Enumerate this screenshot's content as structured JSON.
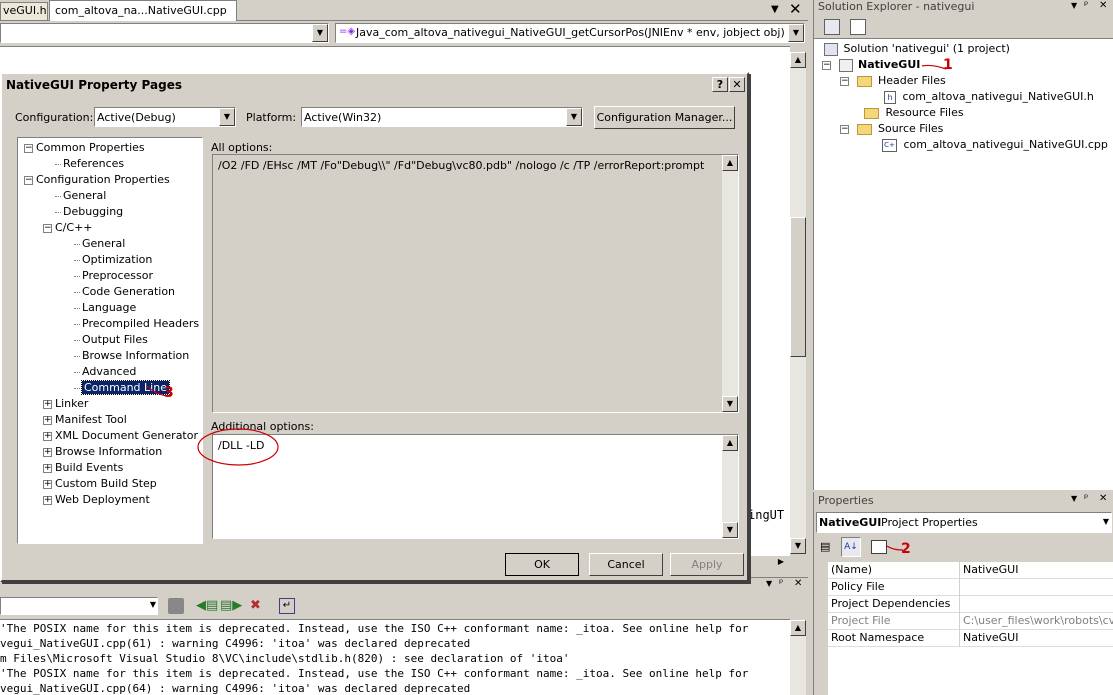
{
  "editor": {
    "tabs": [
      "veGUI.h",
      "com_altova_na...NativeGUI.cpp"
    ],
    "function_dropdown": "Java_com_altova_nativegui_NativeGUI_getCursorPos(JNIEnv * env, jobject obj)",
    "code_fragment": "ingUT"
  },
  "dialog": {
    "title": "NativeGUI Property Pages",
    "help_label": "?",
    "configuration_label": "Configuration:",
    "configuration_value": "Active(Debug)",
    "platform_label": "Platform:",
    "platform_value": "Active(Win32)",
    "config_manager_label": "Configuration Manager...",
    "tree": [
      {
        "label": "Common Properties",
        "expander": "−"
      },
      {
        "label": "References"
      },
      {
        "label": "Configuration Properties",
        "expander": "−"
      },
      {
        "label": "General"
      },
      {
        "label": "Debugging"
      },
      {
        "label": "C/C++",
        "expander": "−"
      },
      {
        "label": "General"
      },
      {
        "label": "Optimization"
      },
      {
        "label": "Preprocessor"
      },
      {
        "label": "Code Generation"
      },
      {
        "label": "Language"
      },
      {
        "label": "Precompiled Headers"
      },
      {
        "label": "Output Files"
      },
      {
        "label": "Browse Information"
      },
      {
        "label": "Advanced"
      },
      {
        "label": "Command Line",
        "selected": true
      },
      {
        "label": "Linker",
        "expander": "+"
      },
      {
        "label": "Manifest Tool",
        "expander": "+"
      },
      {
        "label": "XML Document Generator",
        "expander": "+"
      },
      {
        "label": "Browse Information",
        "expander": "+"
      },
      {
        "label": "Build Events",
        "expander": "+"
      },
      {
        "label": "Custom Build Step",
        "expander": "+"
      },
      {
        "label": "Web Deployment",
        "expander": "+"
      }
    ],
    "all_options_label": "All options:",
    "all_options_value": "/O2 /FD /EHsc /MT /Fo\"Debug\\\\\" /Fd\"Debug\\vc80.pdb\" /nologo /c /TP /errorReport:prompt",
    "additional_options_label": "Additional options:",
    "additional_options_value": "/DLL -LD",
    "ok_label": "OK",
    "cancel_label": "Cancel",
    "apply_label": "Apply"
  },
  "annotations": [
    "1",
    "2",
    "3"
  ],
  "output": {
    "lines": [
      "'The POSIX name for this item is deprecated. Instead, use the ISO C++ conformant name: _itoa. See online help for",
      "vegui_NativeGUI.cpp(61) : warning C4996: 'itoa' was declared deprecated",
      "m Files\\Microsoft Visual Studio 8\\VC\\include\\stdlib.h(820) : see declaration of 'itoa'",
      "'The POSIX name for this item is deprecated. Instead, use the ISO C++ conformant name: _itoa. See online help for",
      "vegui_NativeGUI.cpp(64) : warning C4996: 'itoa' was declared deprecated"
    ]
  },
  "solution_explorer": {
    "title": "Solution Explorer - nativegui",
    "solution": "Solution 'nativegui' (1 project)",
    "project": "NativeGUI",
    "header_files": "Header Files",
    "header_file": "com_altova_nativegui_NativeGUI.h",
    "resource_files": "Resource Files",
    "source_files": "Source Files",
    "source_file": "com_altova_nativegui_NativeGUI.cpp"
  },
  "properties": {
    "title": "Properties",
    "object_name": "NativeGUI",
    "object_type": "Project Properties",
    "rows": [
      {
        "name": "(Name)",
        "value": "NativeGUI"
      },
      {
        "name": "Policy File",
        "value": ""
      },
      {
        "name": "Project Dependencies",
        "value": ""
      },
      {
        "name": "Project File",
        "value": "C:\\user_files\\work\\robots\\cvs\\n",
        "disabled": true
      },
      {
        "name": "Root Namespace",
        "value": "NativeGUI"
      }
    ]
  },
  "colors": {
    "selection": "#0a246a",
    "annotation": "#cc0000",
    "face": "#d4d0c8"
  }
}
